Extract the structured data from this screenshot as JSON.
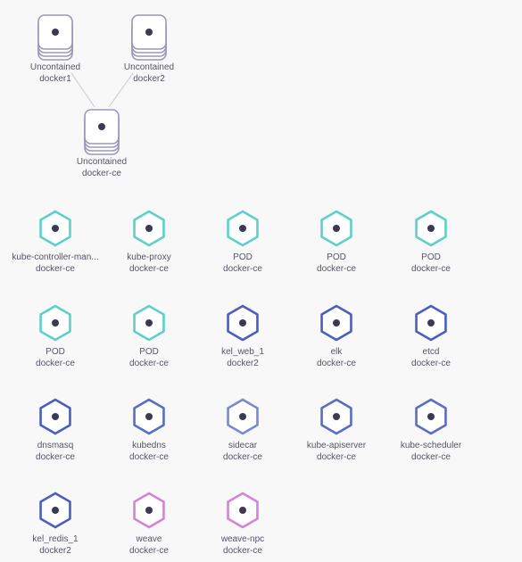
{
  "colors": {
    "background": "#f8f8f8",
    "label_text": "#555566",
    "dot": "#3b3a55",
    "host_stroke": "#9a98b4",
    "edge": "#c8c8d0",
    "pod_teal": "#5fd0c8",
    "service_blue_dark": "#4a5ec0",
    "service_blue_mid": "#5a6cc4",
    "service_blue_light": "#7b89cc",
    "weave_pink": "#d384d6"
  },
  "hosts": [
    {
      "id": "h1",
      "label": "Uncontained",
      "sublabel": "docker1",
      "icon": "host-stack-icon"
    },
    {
      "id": "h2",
      "label": "Uncontained",
      "sublabel": "docker2",
      "icon": "host-stack-icon"
    },
    {
      "id": "h3",
      "label": "Uncontained",
      "sublabel": "docker-ce",
      "icon": "host-stack-icon"
    }
  ],
  "edges": [
    {
      "from": "h1",
      "to": "h3"
    },
    {
      "from": "h2",
      "to": "h3"
    }
  ],
  "containers": [
    {
      "label": "kube-controller-man...",
      "sublabel": "docker-ce",
      "color": "#5fd0c8"
    },
    {
      "label": "kube-proxy",
      "sublabel": "docker-ce",
      "color": "#5fd0c8"
    },
    {
      "label": "POD",
      "sublabel": "docker-ce",
      "color": "#5fd0c8"
    },
    {
      "label": "POD",
      "sublabel": "docker-ce",
      "color": "#5fd0c8"
    },
    {
      "label": "POD",
      "sublabel": "docker-ce",
      "color": "#5fd0c8"
    },
    {
      "label": "POD",
      "sublabel": "docker-ce",
      "color": "#5fd0c8"
    },
    {
      "label": "POD",
      "sublabel": "docker-ce",
      "color": "#5fd0c8"
    },
    {
      "label": "kel_web_1",
      "sublabel": "docker2",
      "color": "#4a5ec0"
    },
    {
      "label": "elk",
      "sublabel": "docker-ce",
      "color": "#4a5ec0"
    },
    {
      "label": "etcd",
      "sublabel": "docker-ce",
      "color": "#4a5ec0"
    },
    {
      "label": "dnsmasq",
      "sublabel": "docker-ce",
      "color": "#4a5ec0"
    },
    {
      "label": "kubedns",
      "sublabel": "docker-ce",
      "color": "#5a6cc4"
    },
    {
      "label": "sidecar",
      "sublabel": "docker-ce",
      "color": "#7b89cc"
    },
    {
      "label": "kube-apiserver",
      "sublabel": "docker-ce",
      "color": "#5a6cc4"
    },
    {
      "label": "kube-scheduler",
      "sublabel": "docker-ce",
      "color": "#5a6cc4"
    },
    {
      "label": "kel_redis_1",
      "sublabel": "docker2",
      "color": "#4a5ec0"
    },
    {
      "label": "weave",
      "sublabel": "docker-ce",
      "color": "#d384d6"
    },
    {
      "label": "weave-npc",
      "sublabel": "docker-ce",
      "color": "#d384d6"
    }
  ]
}
